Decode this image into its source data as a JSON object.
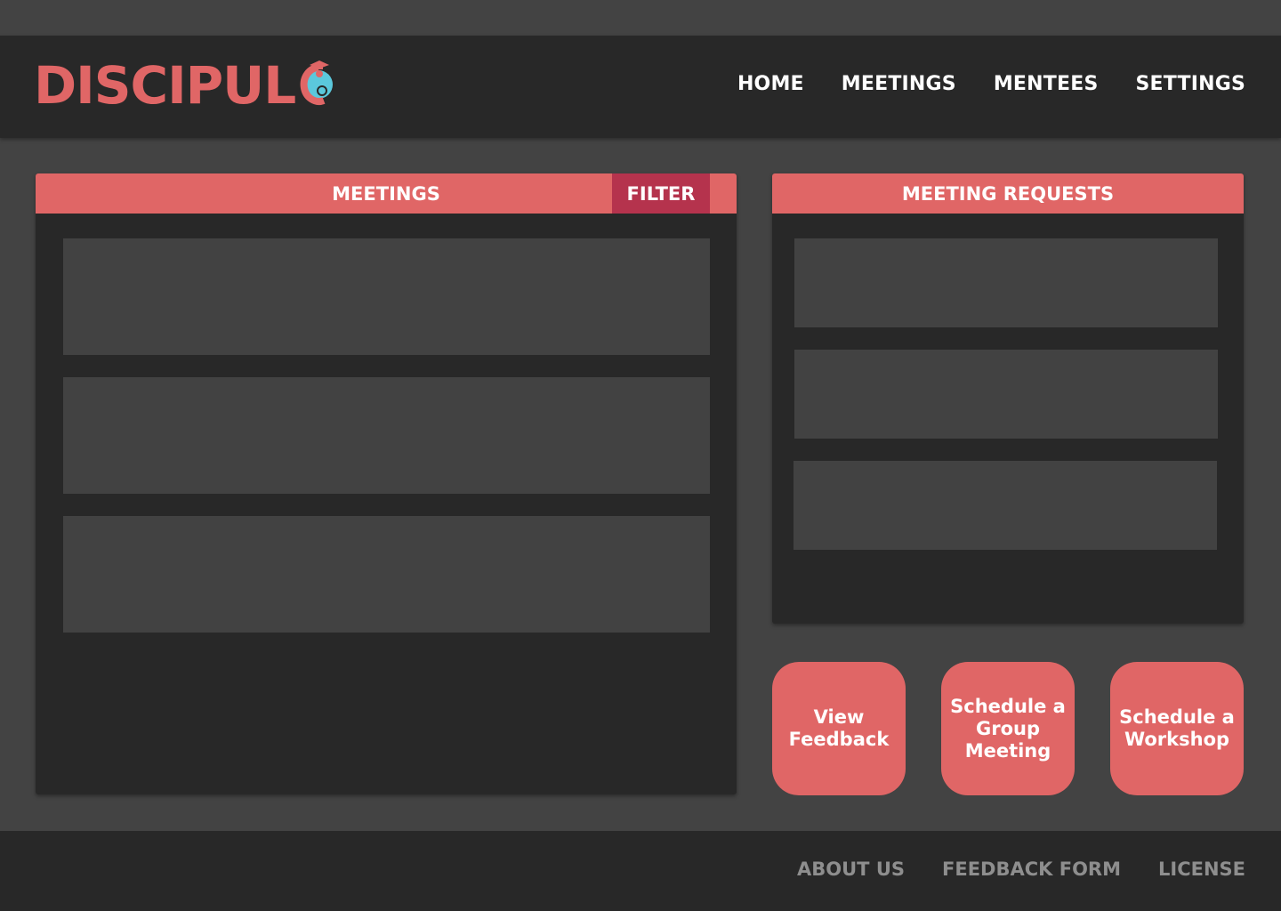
{
  "brand": {
    "name": "DISCIPULO",
    "logo_text": "DISCIPUL",
    "logo_mark": "graduate-o-icon",
    "color_primary": "#e06666",
    "color_accent": "#5bc8dc"
  },
  "nav": {
    "items": [
      {
        "label": "HOME"
      },
      {
        "label": "MEETINGS"
      },
      {
        "label": "MENTEES"
      },
      {
        "label": "SETTINGS"
      }
    ]
  },
  "meetings_panel": {
    "title": "MEETINGS",
    "filter_label": "FILTER",
    "filter_color": "#b5334d"
  },
  "requests_panel": {
    "title": "MEETING REQUESTS"
  },
  "actions": [
    {
      "label": "View Feedback"
    },
    {
      "label": "Schedule a Group Meeting"
    },
    {
      "label": "Schedule a Workshop"
    }
  ],
  "footer": {
    "links": [
      {
        "label": "ABOUT US"
      },
      {
        "label": "FEEDBACK FORM"
      },
      {
        "label": "LICENSE"
      }
    ]
  }
}
